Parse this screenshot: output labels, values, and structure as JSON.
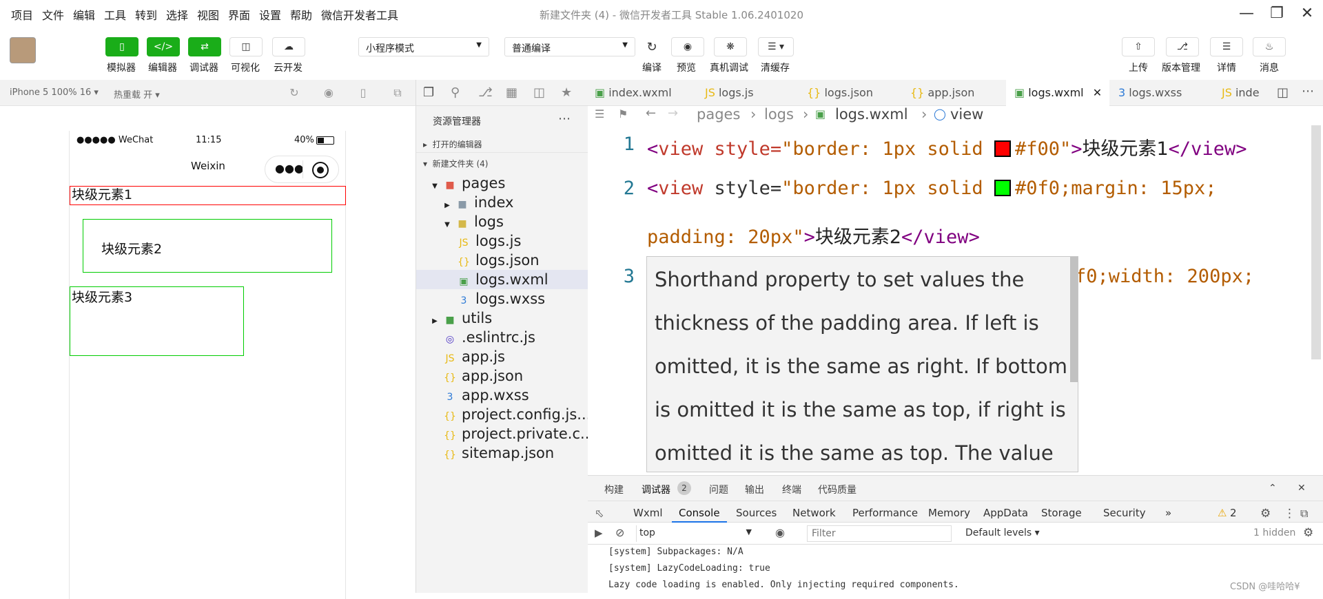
{
  "menu": [
    "项目",
    "文件",
    "编辑",
    "工具",
    "转到",
    "选择",
    "视图",
    "界面",
    "设置",
    "帮助",
    "微信开发者工具"
  ],
  "window_title": "新建文件夹 (4) - 微信开发者工具 Stable 1.06.2401020",
  "toolbar": {
    "simulator": "模拟器",
    "editor": "编辑器",
    "debugger": "调试器",
    "visual": "可视化",
    "cloud": "云开发",
    "mode_select": "小程序模式",
    "compile_select": "普通编译",
    "compile": "编译",
    "preview": "预览",
    "real_debug": "真机调试",
    "clear_cache": "清缓存",
    "upload": "上传",
    "version": "版本管理",
    "details": "详情",
    "messages": "消息"
  },
  "simbar": {
    "device": "iPhone 5 100% 16 ▾",
    "hot_reload": "热重载 开 ▾"
  },
  "phone": {
    "carrier": "●●●●● WeChat",
    "time": "11:15",
    "battery": "40%",
    "nav_title": "Weixin",
    "block1": "块级元素1",
    "block2": "块级元素2",
    "block3": "块级元素3"
  },
  "explorer": {
    "title": "资源管理器",
    "open_editors": "打开的编辑器",
    "folder": "新建文件夹 (4)",
    "tree": [
      "pages",
      "index",
      "logs",
      "logs.js",
      "logs.json",
      "logs.wxml",
      "logs.wxss",
      "utils",
      ".eslintrc.js",
      "app.js",
      "app.json",
      "app.wxss",
      "project.config.js...",
      "project.private.c...",
      "sitemap.json"
    ]
  },
  "tabs": [
    "index.wxml",
    "logs.js",
    "logs.json",
    "app.json",
    "logs.wxml",
    "logs.wxss",
    "inde"
  ],
  "breadcrumb": [
    "pages",
    "logs",
    "logs.wxml",
    "view"
  ],
  "code": {
    "line1_attr": "view style=",
    "line1_str_a": "\"border: 1px solid ",
    "line1_str_b": "#f00\"",
    "line1_text": "块级元素1",
    "line2_str_a": "\"border: 1px solid ",
    "line2_str_b": "#0f0;margin: 15px;",
    "line2b_str": "padding: 20px\"",
    "line2_text": "块级元素2",
    "line3_tail": "f0;width: 200px;",
    "colors": {
      "red": "#ff0000",
      "green": "#00ff00"
    }
  },
  "tooltip": [
    "Shorthand property to set values the",
    "thickness of the padding area. If left is",
    "omitted, it is the same as right. If bottom",
    "is omitted it is the same as top, if right is",
    "omitted it is the same as top. The value"
  ],
  "devtools": {
    "top_tabs": [
      "构建",
      "调试器",
      "问题",
      "输出",
      "终端",
      "代码质量"
    ],
    "badge": "2",
    "tabs": [
      "Wxml",
      "Console",
      "Sources",
      "Network",
      "Performance",
      "Memory",
      "AppData",
      "Storage",
      "Security"
    ],
    "warn_count": "2",
    "context": "top",
    "filter_placeholder": "Filter",
    "levels": "Default levels ▾",
    "hidden": "1 hidden",
    "console": [
      "[system] Subpackages: N/A",
      "[system] LazyCodeLoading: true",
      "Lazy code loading is enabled. Only injecting required components."
    ]
  },
  "watermark": "CSDN @哇哈哈¥"
}
